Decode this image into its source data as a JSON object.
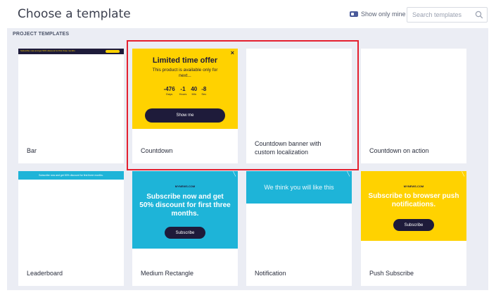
{
  "header": {
    "title": "Choose a template",
    "show_only_mine_label": "Show only mine",
    "search_placeholder": "Search templates"
  },
  "section": {
    "label": "PROJECT TEMPLATES"
  },
  "templates": [
    {
      "name": "Bar",
      "preview_text": "Subscribe now and get 50% discount for first three months"
    },
    {
      "name": "Countdown",
      "preview": {
        "title": "Limited time offer",
        "subtitle": "This product is available only for next...",
        "days_value": "-476",
        "days_label": "Days",
        "hours_value": "-1",
        "hours_label": "Hours",
        "min_value": "40",
        "min_label": "Min",
        "sec_value": "-8",
        "sec_label": "Sec",
        "button": "Show me",
        "close": "×"
      }
    },
    {
      "name": "Countdown banner with custom localization"
    },
    {
      "name": "Countdown on action"
    },
    {
      "name": "Leaderboard",
      "preview_text": "Subscribe now and get 50% discount for first three months."
    },
    {
      "name": "Medium Rectangle",
      "preview": {
        "brand": "MYNEWS.COM",
        "headline": "Subscribe now and get 50% discount for first three months.",
        "button": "Subscribe"
      }
    },
    {
      "name": "Notification",
      "preview": {
        "headline": "We think you will like this"
      }
    },
    {
      "name": "Push Subscribe",
      "preview": {
        "brand": "MYNEWS.COM",
        "headline": "Subscribe to browser push notifications.",
        "button": "Subscribe"
      }
    }
  ],
  "colors": {
    "yellow": "#ffd200",
    "cyan": "#1eb4d8",
    "navy": "#1e1b3a",
    "highlight": "#e4202f"
  }
}
